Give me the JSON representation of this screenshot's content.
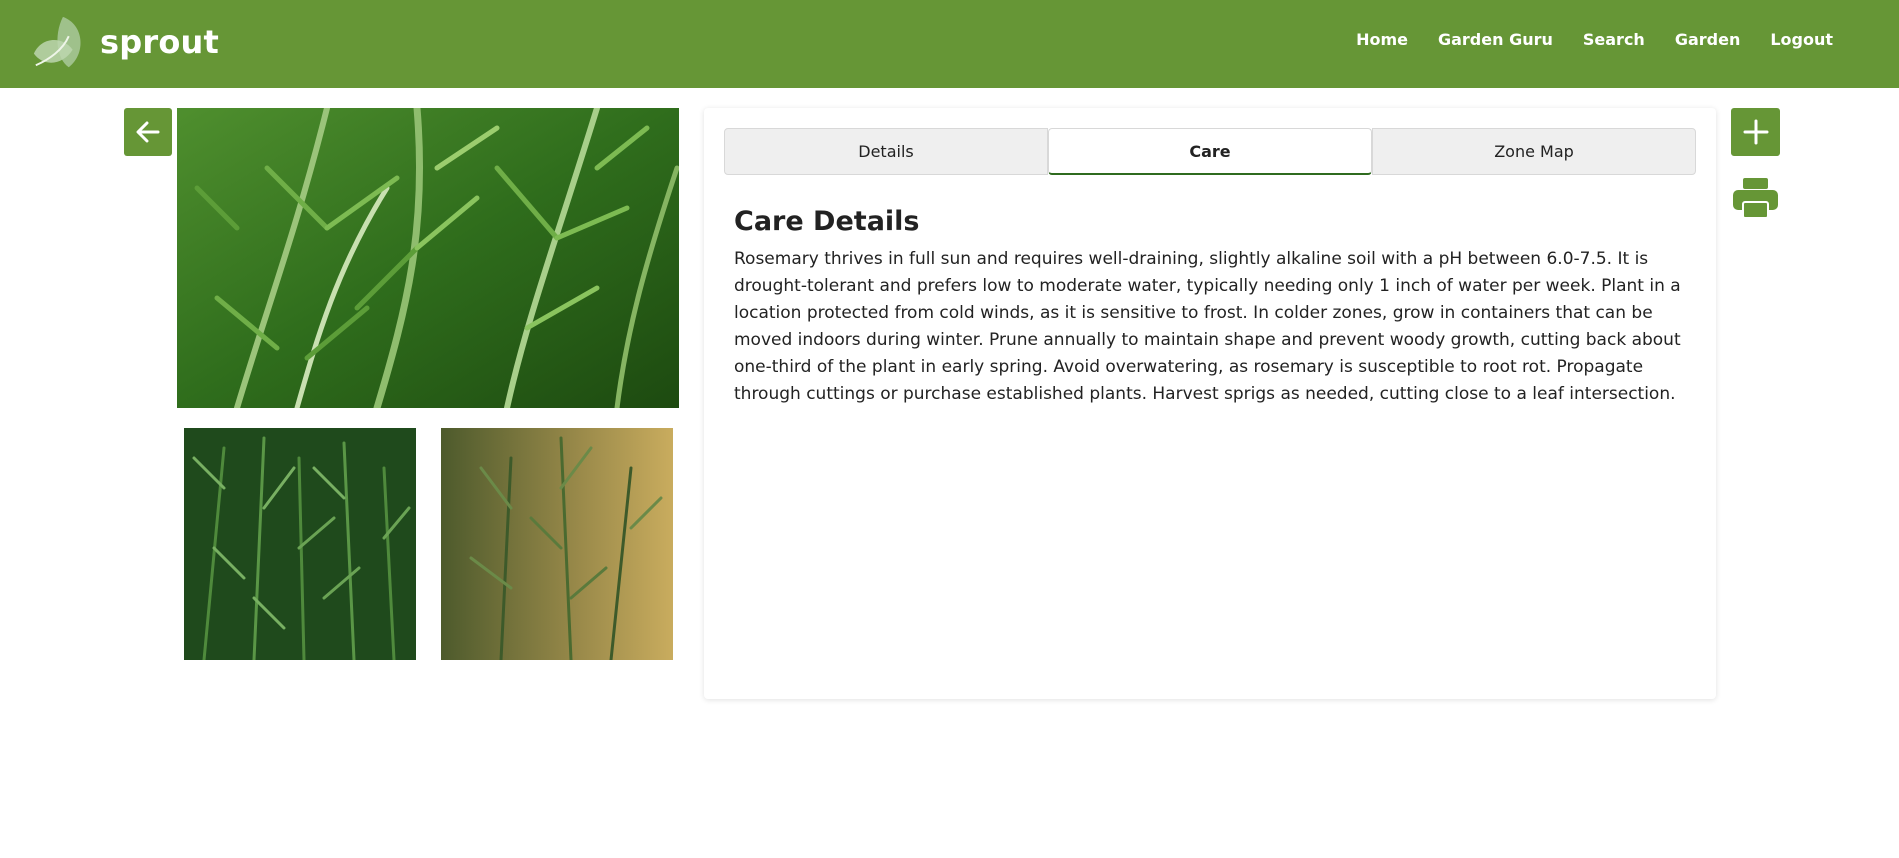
{
  "app": {
    "name": "sprout",
    "brand_color": "#669636"
  },
  "nav": {
    "items": [
      {
        "label": "Home"
      },
      {
        "label": "Garden Guru"
      },
      {
        "label": "Search"
      },
      {
        "label": "Garden"
      },
      {
        "label": "Logout"
      }
    ]
  },
  "buttons": {
    "back": "arrow-left-icon",
    "add": "plus-icon",
    "print": "printer-icon"
  },
  "images": {
    "main": "rosemary-closeup-photo",
    "thumbs": [
      "rosemary-bush-photo",
      "rosemary-sprigs-photo"
    ]
  },
  "tabs": [
    {
      "label": "Details",
      "active": false
    },
    {
      "label": "Care",
      "active": true
    },
    {
      "label": "Zone Map",
      "active": false
    }
  ],
  "care": {
    "title": "Care Details",
    "text": "Rosemary thrives in full sun and requires well-draining, slightly alkaline soil with a pH between 6.0-7.5. It is drought-tolerant and prefers low to moderate water, typically needing only 1 inch of water per week. Plant in a location protected from cold winds, as it is sensitive to frost. In colder zones, grow in containers that can be moved indoors during winter. Prune annually to maintain shape and prevent woody growth, cutting back about one-third of the plant in early spring. Avoid overwatering, as rosemary is susceptible to root rot. Propagate through cuttings or purchase established plants. Harvest sprigs as needed, cutting close to a leaf intersection."
  }
}
